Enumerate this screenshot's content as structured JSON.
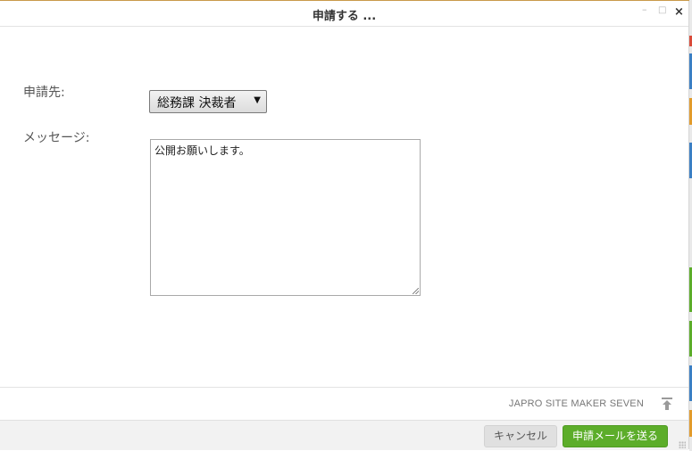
{
  "dialog": {
    "title": "申請する ..."
  },
  "form": {
    "destination_label": "申請先:",
    "destination_value": "総務課 決裁者",
    "message_label": "メッセージ:",
    "message_value": "公開お願いします。"
  },
  "footer": {
    "brand": "JAPRO SITE MAKER SEVEN"
  },
  "buttons": {
    "cancel": "キャンセル",
    "send": "申請メールを送る"
  },
  "colors": {
    "send_button": "#5cad2a",
    "cancel_button": "#e0e0e0"
  }
}
